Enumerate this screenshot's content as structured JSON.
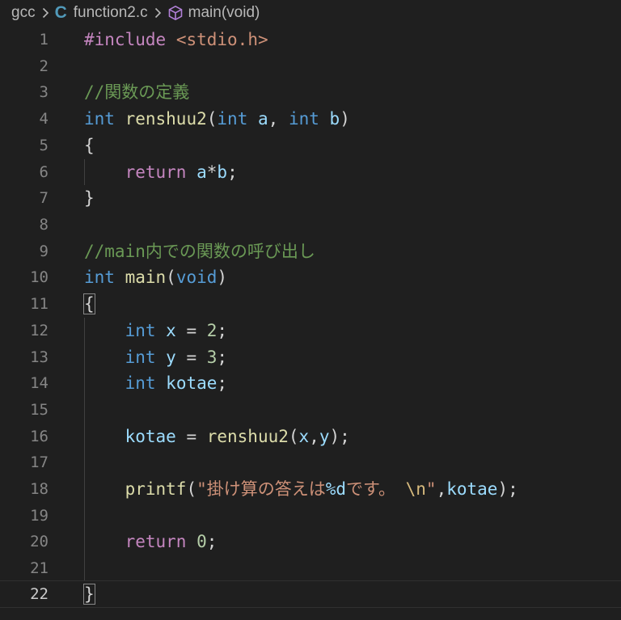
{
  "breadcrumb": {
    "folder": "gcc",
    "file": "function2.c",
    "file_icon_glyph": "C",
    "symbol": "main(void)",
    "symbol_icon": "cube-icon",
    "separator_icon": "chevron-right-icon"
  },
  "editor": {
    "current_line": 22,
    "lines": [
      {
        "n": "1"
      },
      {
        "n": "2"
      },
      {
        "n": "3"
      },
      {
        "n": "4"
      },
      {
        "n": "5"
      },
      {
        "n": "6"
      },
      {
        "n": "7"
      },
      {
        "n": "8"
      },
      {
        "n": "9"
      },
      {
        "n": "10"
      },
      {
        "n": "11"
      },
      {
        "n": "12"
      },
      {
        "n": "13"
      },
      {
        "n": "14"
      },
      {
        "n": "15"
      },
      {
        "n": "16"
      },
      {
        "n": "17"
      },
      {
        "n": "18"
      },
      {
        "n": "19"
      },
      {
        "n": "20"
      },
      {
        "n": "21"
      },
      {
        "n": "22"
      }
    ],
    "tokens": {
      "l1_pre": "#include",
      "l1_hdr": "<stdio.h>",
      "l3_cmt": "//関数の定義",
      "l4_int": "int",
      "l4_fn": "renshuu2",
      "l4_open": "(",
      "l4_int_a": "int",
      "l4_a": "a",
      "l4_comma": ", ",
      "l4_int_b": "int",
      "l4_b": "b",
      "l4_close": ")",
      "l5_brace": "{",
      "l6_return": "return",
      "l6_a": "a",
      "l6_star": "*",
      "l6_b": "b",
      "l6_semi": ";",
      "l7_brace": "}",
      "l9_cmt": "//main内での関数の呼び出し",
      "l10_int": "int",
      "l10_fn": "main",
      "l10_open": "(",
      "l10_void": "void",
      "l10_close": ")",
      "l11_brace": "{",
      "l12_int": "int",
      "l12_x": "x",
      "l12_eq": " = ",
      "l12_num": "2",
      "l12_semi": ";",
      "l13_int": "int",
      "l13_y": "y",
      "l13_eq": " = ",
      "l13_num": "3",
      "l13_semi": ";",
      "l14_int": "int",
      "l14_kotae": "kotae",
      "l14_semi": ";",
      "l16_kotae": "kotae",
      "l16_eq": " = ",
      "l16_fn": "renshuu2",
      "l16_open": "(",
      "l16_x": "x",
      "l16_comma": ",",
      "l16_y": "y",
      "l16_close": ");",
      "l18_fn": "printf",
      "l18_open": "(",
      "l18_str1": "\"掛け算の答えは",
      "l18_fmt": "%d",
      "l18_str2": "です。",
      "l18_esc": "\\n",
      "l18_str3": "\"",
      "l18_comma": ",",
      "l18_kotae": "kotae",
      "l18_close": ");",
      "l20_return": "return",
      "l20_num": "0",
      "l20_semi": ";",
      "l22_brace": "}"
    }
  }
}
